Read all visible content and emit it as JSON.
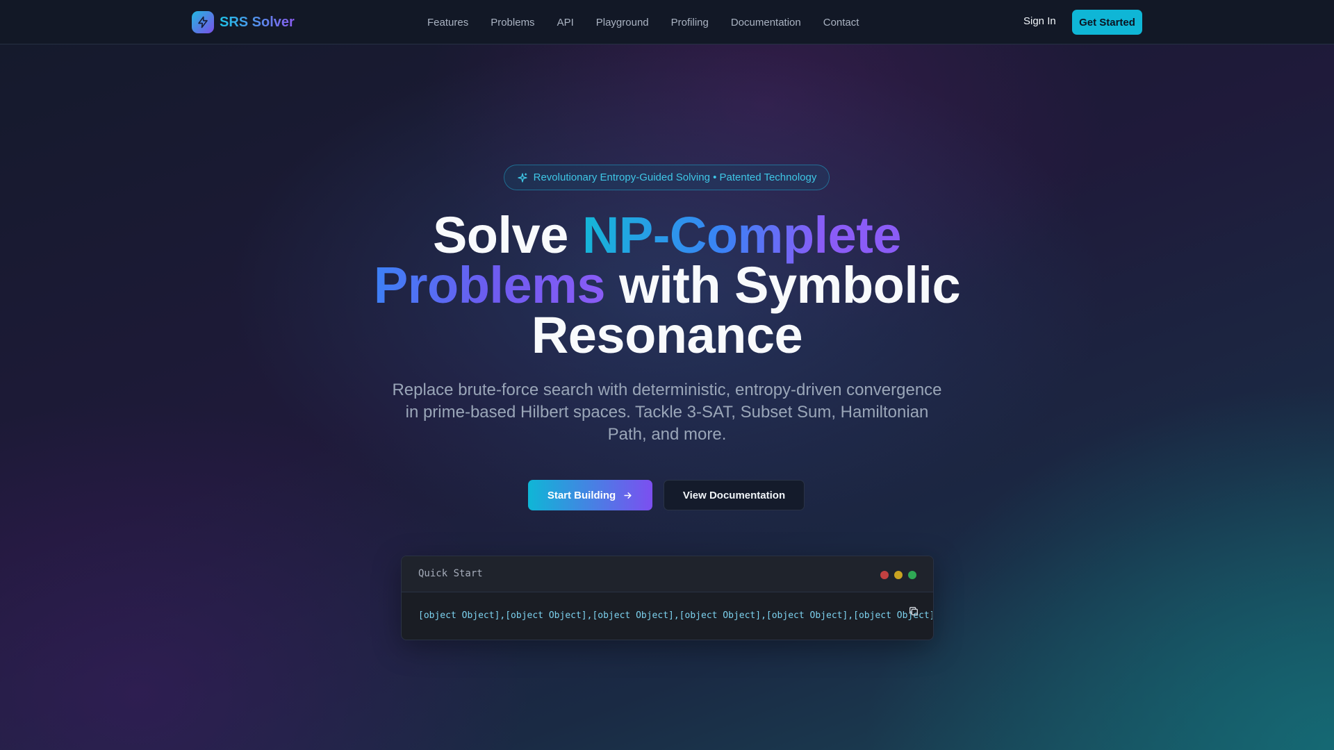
{
  "nav": {
    "brand_name": "SRS Solver",
    "brand_icon": "lightning-icon",
    "links": [
      "Features",
      "Problems",
      "API",
      "Playground",
      "Profiling",
      "Documentation",
      "Contact"
    ],
    "sign_in": "Sign In",
    "get_started": "Get Started"
  },
  "hero": {
    "badge_icon": "sparkle-icon",
    "badge_text": "Revolutionary Entropy-Guided Solving • Patented Technology",
    "headline": {
      "part1": "Solve ",
      "highlight1": "NP-Complete",
      "highlight2": "Problems",
      "part2": " with Symbolic",
      "part3": "Resonance"
    },
    "subtitle": "Replace brute-force search with deterministic, entropy-driven convergence in prime-based Hilbert spaces. Tackle 3-SAT, Subset Sum, Hamiltonian Path, and more.",
    "primary_button": "Start Building",
    "secondary_button": "View Documentation"
  },
  "quick_start": {
    "title": "Quick Start",
    "code": "[object Object],[object Object],[object Object],[object Object],[object Object],[object Object]",
    "window_dots": [
      "#ef4444",
      "#eab308",
      "#22c55e"
    ],
    "copy_icon": "copy-icon"
  },
  "colors": {
    "accent_cyan": "#0fb6d6",
    "accent_violet": "#7c4ff0",
    "nav_background": "#121826"
  }
}
